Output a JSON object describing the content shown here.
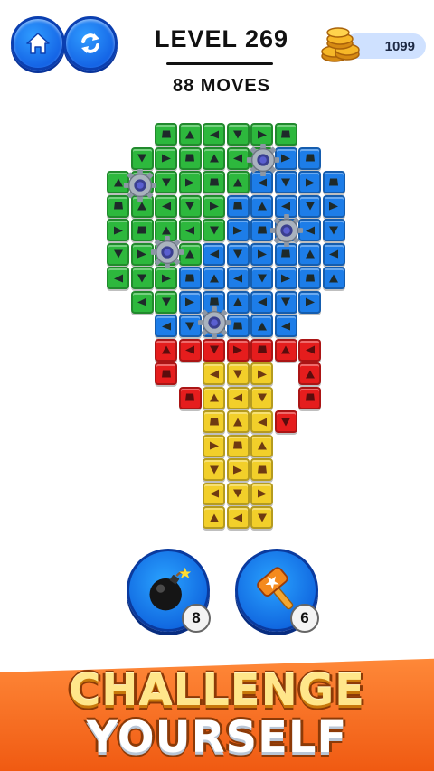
{
  "header": {
    "level_label": "LEVEL 269",
    "moves_label": "88 MOVES",
    "home_icon": "home-icon",
    "refresh_icon": "refresh-icon"
  },
  "currency": {
    "coins": "1099",
    "icon": "coin-stack-icon"
  },
  "board": {
    "colors": {
      "G": "#2db83d",
      "B": "#1d7de8",
      "R": "#e51d1d",
      "Y": "#f2cf2a",
      "shape": "#1e2a2a",
      "shape_on_yellow": "#6e3a12",
      "shape_on_red": "#5a0d0d"
    },
    "grid": [
      "..GGGGGG..",
      ".GGGGGGBB.",
      "GGGGGGBBBB",
      "GGGGGBBBBB",
      "GGGGGBBBBB",
      "GGGGBBBBBB",
      "GGGBBBBBBB",
      ".GGBBBBBB.",
      "..BBBBBB..",
      "..RRRRRRR.",
      "..R.YYY.R.",
      "...RYYY.R.",
      "....YYYR..",
      "....YYY...",
      "....YYY...",
      "....YYY...",
      "....YYY..."
    ],
    "gear_icon": "gear-icon"
  },
  "boosters": [
    {
      "name": "bomb",
      "icon": "bomb-icon",
      "count": "8"
    },
    {
      "name": "hammer",
      "icon": "hammer-icon",
      "count": "6"
    }
  ],
  "banner": {
    "line1": "CHALLENGE",
    "line2": "YOURSELF"
  }
}
